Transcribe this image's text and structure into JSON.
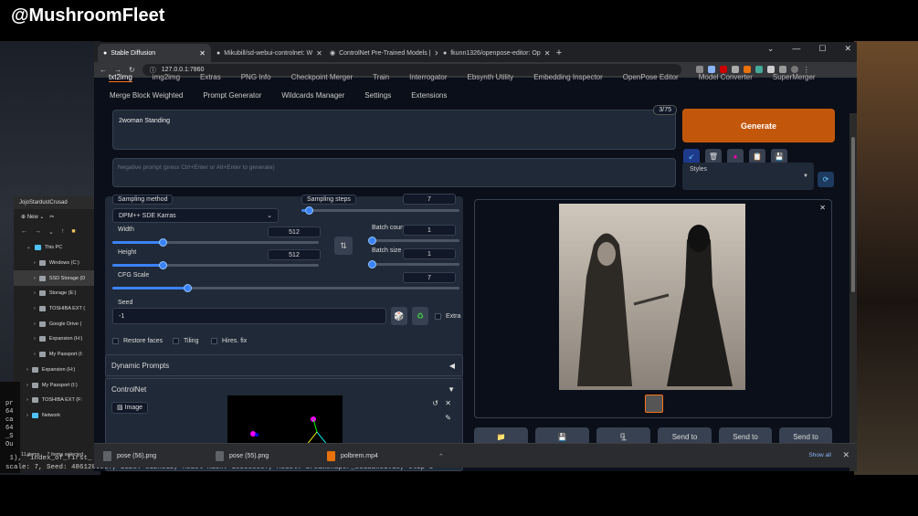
{
  "watermark": "@MushroomFleet",
  "browser": {
    "tabs": [
      {
        "label": "Stable Diffusion",
        "active": true
      },
      {
        "label": "Mikubill/sd-webui-controlnet: W"
      },
      {
        "label": "ControlNet Pre-Trained Models |"
      },
      {
        "label": "fkunn1326/openpose-editor: Op"
      }
    ],
    "url": "127.0.0.1:7860"
  },
  "webui": {
    "tabs_row1": [
      "txt2img",
      "img2img",
      "Extras",
      "PNG Info",
      "Checkpoint Merger",
      "Train",
      "Interrogator",
      "Ebsynth Utility",
      "Embedding Inspector",
      "OpenPose Editor",
      "Model Converter",
      "SuperMerger"
    ],
    "tabs_row2": [
      "Merge Block Weighted",
      "Prompt Generator",
      "Wildcards Manager",
      "Settings",
      "Extensions"
    ],
    "prompt": "2woman Standing",
    "token_count": "3/75",
    "negative_placeholder": "Negative prompt (press Ctrl+Enter or Alt+Enter to generate)",
    "generate_label": "Generate",
    "styles_label": "Styles",
    "sampling_method_label": "Sampling method",
    "sampling_method_value": "DPM++ SDE Karras",
    "sampling_steps_label": "Sampling steps",
    "sampling_steps": "7",
    "width_label": "Width",
    "width": "512",
    "height_label": "Height",
    "height": "512",
    "batch_count_label": "Batch count",
    "batch_count": "1",
    "batch_size_label": "Batch size",
    "batch_size": "1",
    "cfg_label": "CFG Scale",
    "cfg": "7",
    "seed_label": "Seed",
    "seed": "-1",
    "extra_label": "Extra",
    "restore_faces": "Restore faces",
    "tiling": "Tiling",
    "hires_fix": "Hires. fix",
    "dynamic_prompts": "Dynamic Prompts",
    "controlnet": "ControlNet",
    "image_tab": "Image",
    "send_to": [
      "Send to",
      "Send to",
      "Send to"
    ]
  },
  "explorer": {
    "title": "JojoStardustCrusad",
    "new_label": "New",
    "items": [
      "This PC",
      "Windows (C:)",
      "SSD Storage (D",
      "Storage (E:)",
      "TOSHIBA EXT (",
      "Google Drive (",
      "Expansion (H:)",
      "My Passport (I:",
      "Expansion (H:)",
      "My Passport (I:)",
      "TOSHIBA EXT (F:",
      "Network"
    ],
    "status_items": "11 items",
    "status_selected": "7 items selected"
  },
  "terminal": {
    "lines": [
      "pr",
      "64",
      "ca",
      "64",
      "_S",
      "Ou"
    ],
    "line1": " 1), \"index_of_first_",
    "line2": "scale: 7, Seed: 4861209237, Size: 512x512, Model hash: 1e0eeec07, Model: dreamshaper_331BakedVae, Clip s"
  },
  "downloads": {
    "items": [
      "pose (56).png",
      "pose (55).png",
      "polbrem.mp4"
    ],
    "show_all": "Show all"
  }
}
